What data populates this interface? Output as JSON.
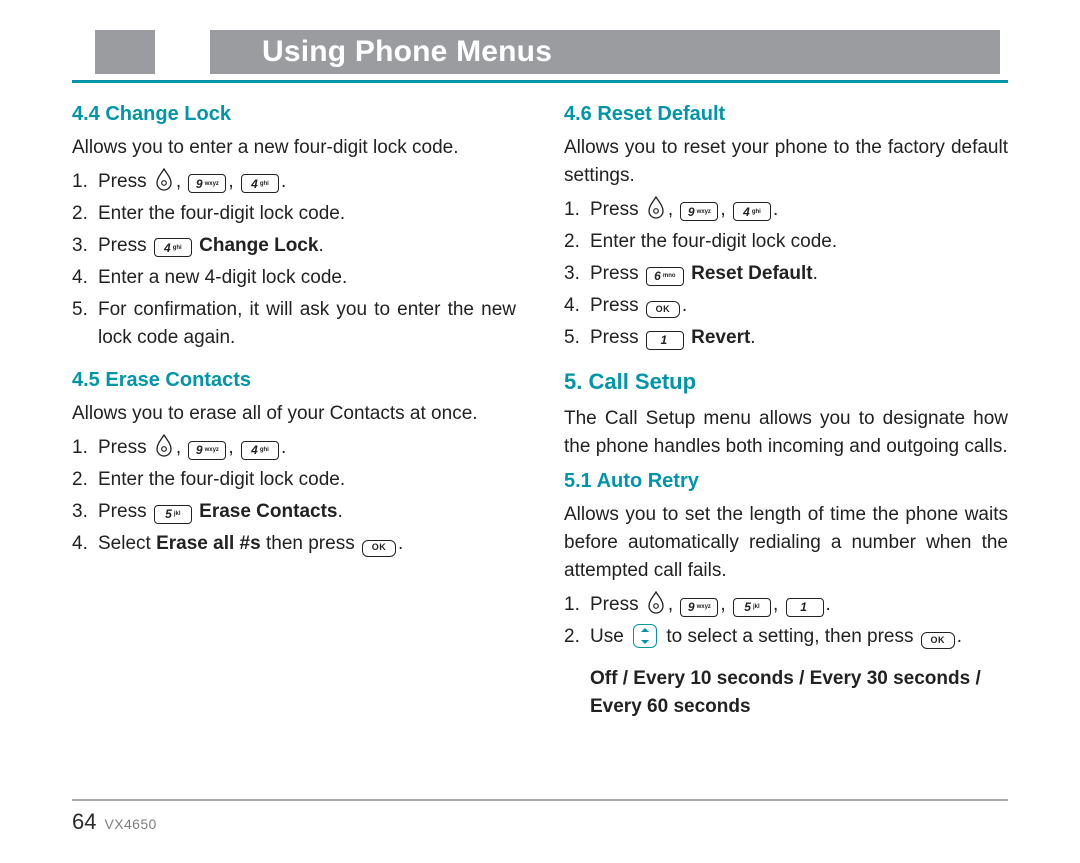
{
  "header": {
    "title": "Using Phone Menus"
  },
  "footer": {
    "page_number": "64",
    "model": "VX4650"
  },
  "icons": {
    "menu": "menu-teardrop-icon",
    "dpad": "dpad-icon"
  },
  "keys": {
    "k1": {
      "digit": "1",
      "letters": ""
    },
    "k4": {
      "digit": "4",
      "letters": "ghi"
    },
    "k5": {
      "digit": "5",
      "letters": "jkl"
    },
    "k6": {
      "digit": "6",
      "letters": "mno"
    },
    "k9": {
      "digit": "9",
      "letters": "wxyz"
    },
    "ok": {
      "label": "OK"
    }
  },
  "left": {
    "s44": {
      "title": "4.4 Change Lock",
      "blurb": "Allows you to enter a new four-digit lock code.",
      "steps": {
        "l1a": "Press",
        "l2": "Enter the four-digit lock code.",
        "l3a": "Press",
        "l3b": "Change Lock",
        "l4": "Enter a new 4-digit lock code.",
        "l5": "For confirmation, it will ask you to enter the new lock code again."
      }
    },
    "s45": {
      "title": "4.5 Erase Contacts",
      "blurb": "Allows you to erase all of your Contacts at once.",
      "steps": {
        "l1a": "Press",
        "l2": "Enter the four-digit lock code.",
        "l3a": "Press",
        "l3b": "Erase Contacts",
        "l4a": "Select",
        "l4b": "Erase all #s",
        "l4c": "then press"
      }
    }
  },
  "right": {
    "s46": {
      "title": "4.6 Reset Default",
      "blurb": "Allows you to reset your phone to the factory default settings.",
      "steps": {
        "l1a": "Press",
        "l2": "Enter the four-digit lock code.",
        "l3a": "Press",
        "l3b": "Reset Default",
        "l4a": "Press",
        "l5a": "Press",
        "l5b": "Revert"
      }
    },
    "s5": {
      "title": "5. Call Setup",
      "blurb": "The Call Setup menu allows you to designate how the phone handles both incoming and outgoing calls."
    },
    "s51": {
      "title": "5.1 Auto Retry",
      "blurb": "Allows you to set the length of time the phone waits before automatically redialing a number when the attempted call fails.",
      "steps": {
        "l1a": "Press",
        "l2a": "Use",
        "l2b": "to select a setting, then press"
      },
      "options": "Off / Every 10 seconds / Every 30 seconds / Every 60 seconds"
    }
  }
}
